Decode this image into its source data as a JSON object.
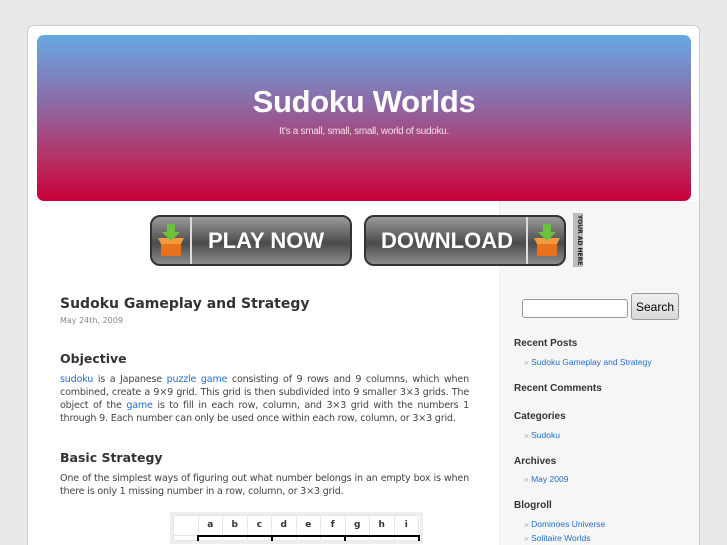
{
  "site": {
    "title": "Sudoku Worlds",
    "tagline": "It's a small, small, small, world of sudoku."
  },
  "banners": {
    "play": "PLAY NOW",
    "download": "DOWNLOAD",
    "ad": "YOUR AD HERE"
  },
  "post": {
    "title": "Sudoku Gameplay and Strategy",
    "date": "May 24th, 2009",
    "objective_heading": "Objective",
    "p1_link1": "sudoku",
    "p1_t1": " is a Japanese ",
    "p1_link2": "puzzle",
    "p1_t2": " ",
    "p1_link3": "game",
    "p1_t3": " consisting of 9 rows and 9 columns, which when combined, create a 9×9 grid. This grid is then subdivided into 9 smaller 3×3 grids. The object of the ",
    "p1_link4": "game",
    "p1_t4": " is to fill in each row, column, and 3×3 grid with the numbers 1 through 9. Each number can only be used once within each row, column, or 3×3 grid.",
    "strategy_heading": "Basic Strategy",
    "p2": "One of the simplest ways of figuring out what number belongs in an empty box is when there is only 1 missing number in a row, column, or 3×3 grid.",
    "grid_columns": [
      "a",
      "b",
      "c",
      "d",
      "e",
      "f",
      "g",
      "h",
      "i"
    ]
  },
  "sidebar": {
    "search_button": "Search",
    "search_value": "",
    "recent_posts": "Recent Posts",
    "recent_posts_items": [
      "Sudoku Gameplay and Strategy"
    ],
    "recent_comments": "Recent Comments",
    "categories": "Categories",
    "categories_items": [
      "Sudoku"
    ],
    "archives": "Archives",
    "archives_items": [
      "May 2009"
    ],
    "blogroll": "Blogroll",
    "blogroll_items": [
      "Dominoes Universe",
      "Solitaire Worlds"
    ]
  }
}
